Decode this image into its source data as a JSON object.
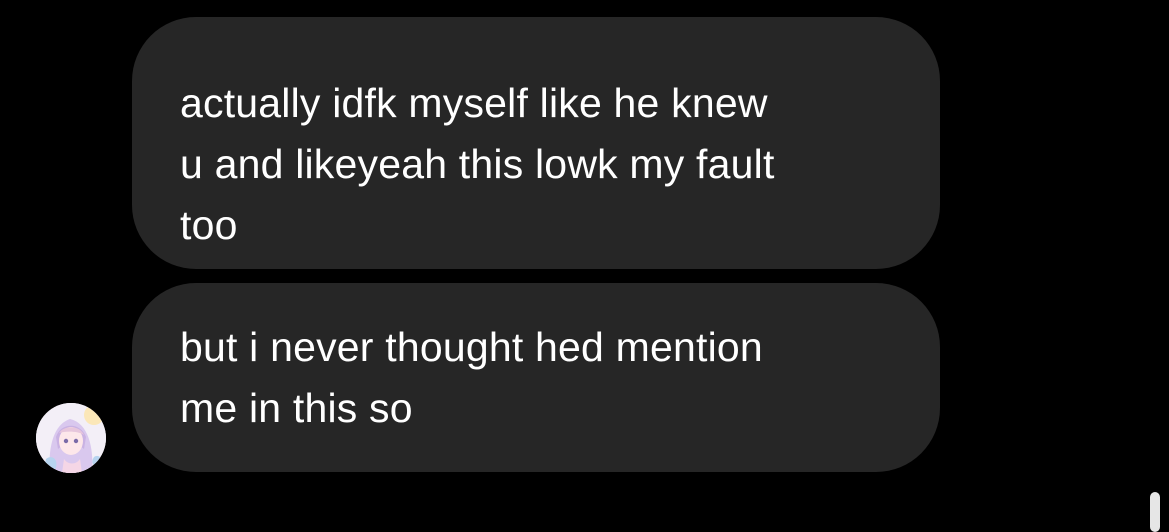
{
  "thread": {
    "messages": [
      {
        "sender": "other",
        "lines": [
          "actually idfk myself like he knew",
          "u and likeyeah this lowk my fault",
          "too"
        ]
      },
      {
        "sender": "other",
        "lines": [
          "but i never thought hed mention",
          "me in this so"
        ]
      }
    ]
  },
  "colors": {
    "background": "#000000",
    "bubble": "#262626",
    "text": "#ffffff"
  },
  "icons": {
    "avatar": "anime-character-avatar",
    "scrollbar": "scroll-indicator"
  }
}
